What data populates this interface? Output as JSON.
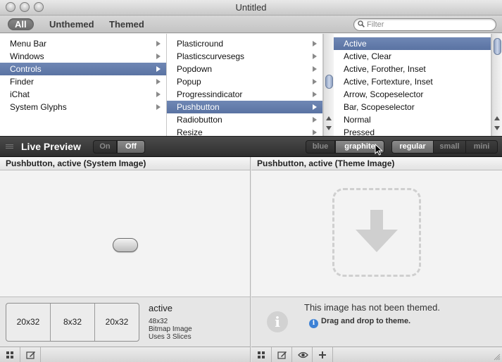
{
  "window": {
    "title": "Untitled"
  },
  "toolbar": {
    "segments": [
      "All",
      "Unthemed",
      "Themed"
    ],
    "filter_placeholder": "Filter"
  },
  "columns": {
    "col1": [
      "Menu Bar",
      "Windows",
      "Controls",
      "Finder",
      "iChat",
      "System Glyphs"
    ],
    "col2": [
      "Plasticround",
      "Plasticscurvesegs",
      "Popdown",
      "Popup",
      "Progressindicator",
      "Pushbutton",
      "Radiobutton",
      "Resize"
    ],
    "col3": [
      "Active",
      "Active, Clear",
      "Active, Forother, Inset",
      "Active, Fortexture, Inset",
      "Arrow, Scopeselector",
      "Bar, Scopeselector",
      "Normal",
      "Pressed"
    ]
  },
  "live_preview": {
    "title": "Live Preview",
    "toggle": [
      "On",
      "Off"
    ],
    "colors": [
      "blue",
      "graphite"
    ],
    "sizes": [
      "regular",
      "small",
      "mini"
    ]
  },
  "left_panel": {
    "title": "Pushbutton, active (System Image)",
    "slices": [
      "20x32",
      "8x32",
      "20x32"
    ],
    "meta": {
      "name": "active",
      "dims": "48x32",
      "type": "Bitmap Image",
      "slices": "Uses 3 Slices"
    }
  },
  "right_panel": {
    "title": "Pushbutton, active (Theme Image)",
    "not_themed": "This image has not been themed.",
    "hint": "Drag and drop to theme."
  },
  "colors": {
    "selection": "#5e77a8",
    "live_bar": "#3a3a3a"
  }
}
